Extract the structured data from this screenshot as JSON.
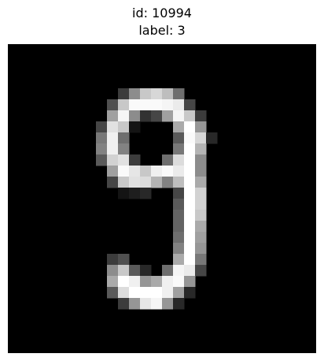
{
  "header": {
    "id_line": "id: 10994",
    "label_line": "label: 3"
  },
  "image": {
    "background": "#000000",
    "grid_size": 28,
    "stroke_cells": [
      [
        8,
        10,
        60
      ],
      [
        8,
        11,
        140
      ],
      [
        8,
        12,
        200
      ],
      [
        8,
        13,
        215
      ],
      [
        8,
        14,
        190
      ],
      [
        8,
        15,
        110
      ],
      [
        9,
        9,
        80
      ],
      [
        9,
        10,
        200
      ],
      [
        9,
        11,
        250
      ],
      [
        9,
        12,
        250
      ],
      [
        9,
        13,
        250
      ],
      [
        9,
        14,
        245
      ],
      [
        9,
        15,
        235
      ],
      [
        9,
        16,
        70
      ],
      [
        10,
        9,
        160
      ],
      [
        10,
        10,
        245
      ],
      [
        10,
        11,
        140
      ],
      [
        10,
        12,
        50
      ],
      [
        10,
        13,
        70
      ],
      [
        10,
        14,
        160
      ],
      [
        10,
        15,
        245
      ],
      [
        10,
        16,
        200
      ],
      [
        10,
        17,
        60
      ],
      [
        11,
        8,
        70
      ],
      [
        11,
        9,
        225
      ],
      [
        11,
        10,
        200
      ],
      [
        11,
        11,
        20
      ],
      [
        11,
        15,
        170
      ],
      [
        11,
        16,
        255
      ],
      [
        11,
        17,
        150
      ],
      [
        12,
        8,
        120
      ],
      [
        12,
        9,
        240
      ],
      [
        12,
        10,
        110
      ],
      [
        12,
        15,
        90
      ],
      [
        12,
        16,
        250
      ],
      [
        12,
        17,
        215
      ],
      [
        12,
        18,
        40
      ],
      [
        13,
        8,
        130
      ],
      [
        13,
        9,
        240
      ],
      [
        13,
        10,
        130
      ],
      [
        13,
        15,
        120
      ],
      [
        13,
        16,
        255
      ],
      [
        13,
        17,
        180
      ],
      [
        14,
        8,
        90
      ],
      [
        14,
        9,
        210
      ],
      [
        14,
        10,
        225
      ],
      [
        14,
        11,
        60
      ],
      [
        14,
        14,
        110
      ],
      [
        14,
        15,
        220
      ],
      [
        14,
        16,
        255
      ],
      [
        14,
        17,
        140
      ],
      [
        15,
        9,
        160
      ],
      [
        15,
        10,
        250
      ],
      [
        15,
        11,
        230
      ],
      [
        15,
        12,
        200
      ],
      [
        15,
        13,
        240
      ],
      [
        15,
        14,
        250
      ],
      [
        15,
        15,
        235
      ],
      [
        15,
        16,
        255
      ],
      [
        15,
        17,
        140
      ],
      [
        16,
        9,
        70
      ],
      [
        16,
        10,
        200
      ],
      [
        16,
        11,
        225
      ],
      [
        16,
        12,
        220
      ],
      [
        16,
        13,
        180
      ],
      [
        16,
        14,
        130
      ],
      [
        16,
        15,
        190
      ],
      [
        16,
        16,
        255
      ],
      [
        16,
        17,
        170
      ],
      [
        17,
        10,
        20
      ],
      [
        17,
        11,
        30
      ],
      [
        17,
        12,
        40
      ],
      [
        17,
        15,
        70
      ],
      [
        17,
        16,
        255
      ],
      [
        17,
        17,
        210
      ],
      [
        18,
        15,
        90
      ],
      [
        18,
        16,
        255
      ],
      [
        18,
        17,
        210
      ],
      [
        19,
        15,
        100
      ],
      [
        19,
        16,
        255
      ],
      [
        19,
        17,
        200
      ],
      [
        20,
        15,
        100
      ],
      [
        20,
        16,
        255
      ],
      [
        20,
        17,
        170
      ],
      [
        21,
        15,
        110
      ],
      [
        21,
        16,
        255
      ],
      [
        21,
        17,
        160
      ],
      [
        22,
        15,
        130
      ],
      [
        22,
        16,
        255
      ],
      [
        22,
        17,
        150
      ],
      [
        23,
        9,
        60
      ],
      [
        23,
        10,
        80
      ],
      [
        23,
        15,
        170
      ],
      [
        23,
        16,
        255
      ],
      [
        23,
        17,
        120
      ],
      [
        24,
        9,
        140
      ],
      [
        24,
        10,
        200
      ],
      [
        24,
        11,
        90
      ],
      [
        24,
        12,
        40
      ],
      [
        24,
        14,
        110
      ],
      [
        24,
        15,
        245
      ],
      [
        24,
        16,
        235
      ],
      [
        24,
        17,
        70
      ],
      [
        25,
        9,
        170
      ],
      [
        25,
        10,
        255
      ],
      [
        25,
        11,
        240
      ],
      [
        25,
        12,
        150
      ],
      [
        25,
        13,
        170
      ],
      [
        25,
        14,
        240
      ],
      [
        25,
        15,
        250
      ],
      [
        25,
        16,
        150
      ],
      [
        26,
        9,
        90
      ],
      [
        26,
        10,
        220
      ],
      [
        26,
        11,
        255
      ],
      [
        26,
        12,
        255
      ],
      [
        26,
        13,
        255
      ],
      [
        26,
        14,
        240
      ],
      [
        26,
        15,
        160
      ],
      [
        26,
        16,
        40
      ],
      [
        27,
        10,
        60
      ],
      [
        27,
        11,
        150
      ],
      [
        27,
        12,
        230
      ],
      [
        27,
        13,
        245
      ],
      [
        27,
        14,
        150
      ],
      [
        27,
        15,
        40
      ]
    ]
  }
}
